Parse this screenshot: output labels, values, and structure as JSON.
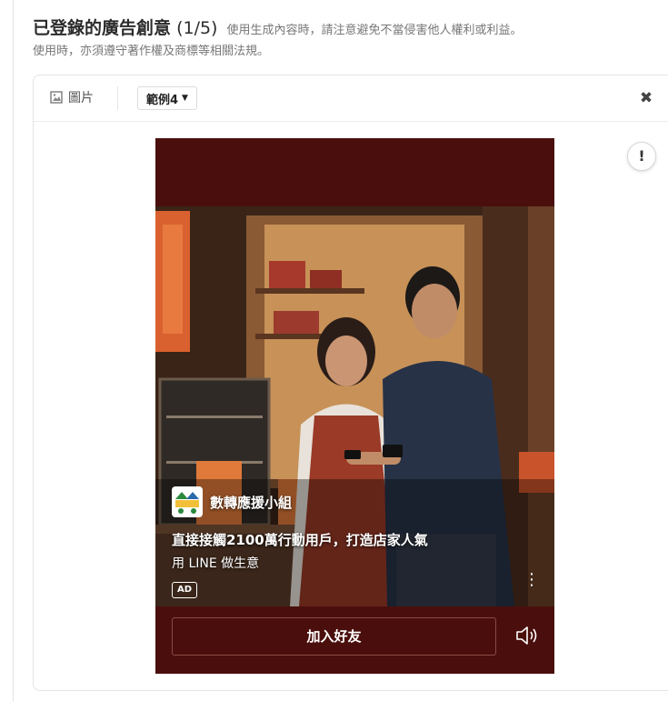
{
  "header": {
    "title": "已登錄的廣告創意",
    "count": "(1/5)",
    "notice_line1": "使用生成內容時，請注意避免不當侵害他人權利或利益。",
    "notice_line2": "使用時，亦須遵守著作權及商標等相關法規。"
  },
  "toolbar": {
    "image_label": "圖片",
    "image_icon": "image-icon",
    "example_select": "範例4",
    "close_icon": "close-icon"
  },
  "warning_icon": "exclamation-icon",
  "ad": {
    "brand_name": "數轉應援小組",
    "headline": "直接接觸2100萬行動用戶，打造店家人氣",
    "subline": "用 LINE 做生意",
    "badge": "AD",
    "cta_label": "加入好友",
    "more_icon": "more-vertical-icon",
    "speaker_icon": "speaker-icon",
    "bg_color": "#4a0f0c"
  }
}
